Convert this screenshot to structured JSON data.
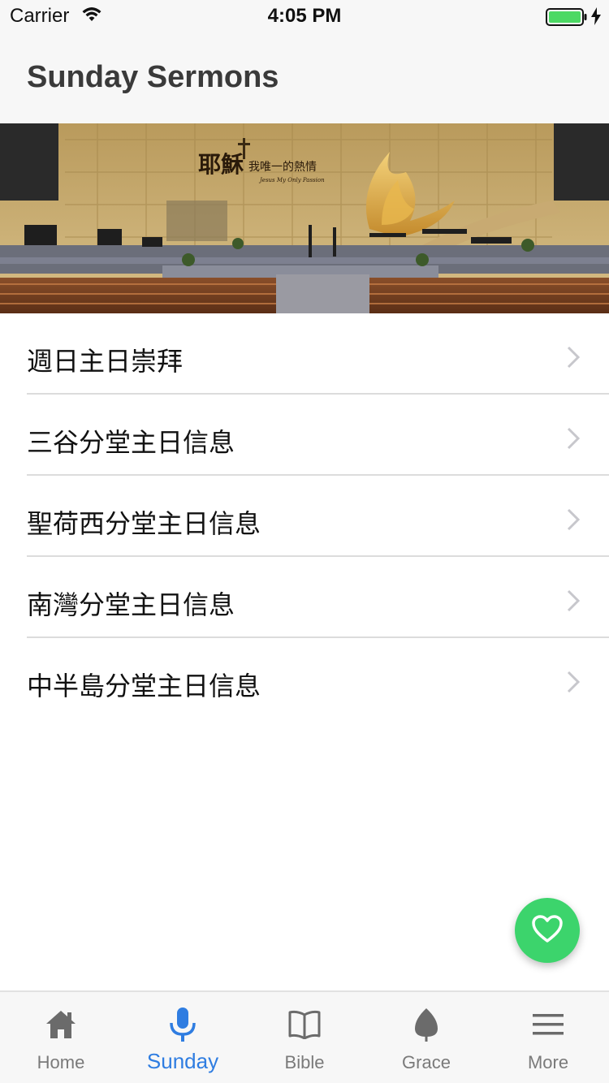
{
  "status_bar": {
    "carrier": "Carrier",
    "time": "4:05 PM",
    "battery_color": "#4cd964"
  },
  "nav": {
    "title": "Sunday Sermons"
  },
  "hero": {
    "banner_text_main": "耶穌",
    "banner_text_sub": "我唯一的熱情",
    "banner_text_en": "Jesus My Only Passion"
  },
  "list": {
    "items": [
      {
        "label": "週日主日崇拜"
      },
      {
        "label": "三谷分堂主日信息"
      },
      {
        "label": "聖荷西分堂主日信息"
      },
      {
        "label": "南灣分堂主日信息"
      },
      {
        "label": "中半島分堂主日信息"
      }
    ]
  },
  "fab": {
    "icon": "heart-icon",
    "color": "#3cd46c"
  },
  "tab_bar": {
    "active_color": "#2f7de1",
    "inactive_color": "#7a7a7a",
    "tabs": [
      {
        "label": "Home",
        "icon": "home-icon"
      },
      {
        "label": "Sunday",
        "icon": "microphone-icon"
      },
      {
        "label": "Bible",
        "icon": "book-icon"
      },
      {
        "label": "Grace",
        "icon": "leaf-icon"
      },
      {
        "label": "More",
        "icon": "menu-icon"
      }
    ]
  }
}
